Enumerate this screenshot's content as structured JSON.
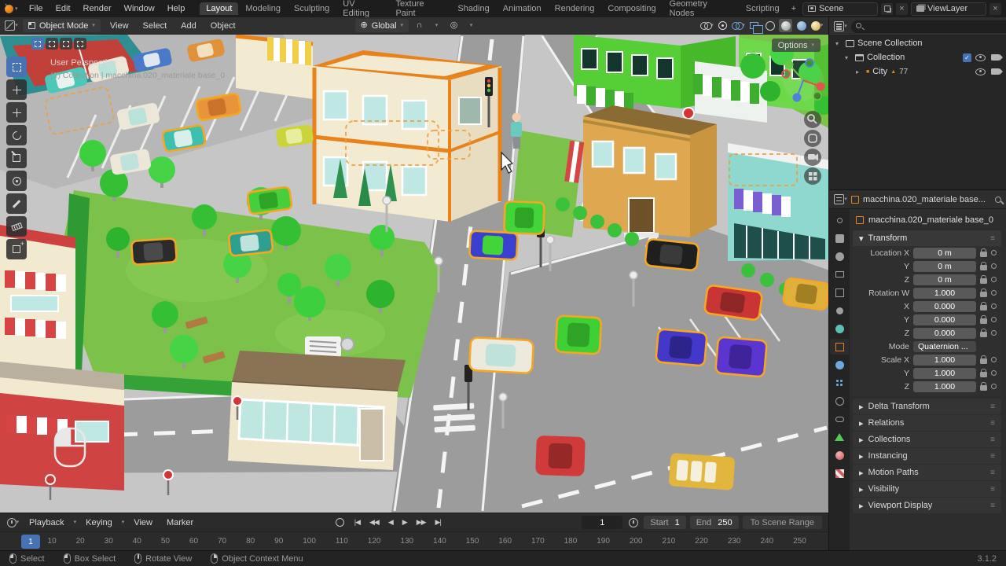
{
  "colors": {
    "accent": "#4772b3",
    "selection": "#f5a623",
    "obj-orange": "#e8821e"
  },
  "topbar": {
    "menus": [
      "File",
      "Edit",
      "Render",
      "Window",
      "Help"
    ],
    "workspaces": [
      "Layout",
      "Modeling",
      "Sculpting",
      "UV Editing",
      "Texture Paint",
      "Shading",
      "Animation",
      "Rendering",
      "Compositing",
      "Geometry Nodes",
      "Scripting"
    ],
    "add": "+",
    "scene": "Scene",
    "viewlayer": "ViewLayer"
  },
  "viewport_header": {
    "mode": "Object Mode",
    "menus": [
      "View",
      "Select",
      "Add",
      "Object"
    ],
    "orientation": "Global",
    "options": "Options"
  },
  "viewport": {
    "overlay_line1": "User Perspective",
    "overlay_line2": "(1) Collection | macchina.020_materiale base_0"
  },
  "outliner": {
    "rows": [
      "Scene Collection",
      "Collection",
      "City"
    ],
    "city_badge": "77"
  },
  "properties": {
    "breadcrumb": "macchina.020_materiale base...",
    "name": "macchina.020_materiale base_0",
    "transform": {
      "title": "Transform",
      "rows1": [
        {
          "label": "Location X",
          "value": "0 m"
        },
        {
          "label": "Y",
          "value": "0 m"
        },
        {
          "label": "Z",
          "value": "0 m"
        },
        {
          "label": "Rotation W",
          "value": "1.000"
        },
        {
          "label": "X",
          "value": "0.000"
        },
        {
          "label": "Y",
          "value": "0.000"
        },
        {
          "label": "Z",
          "value": "0.000"
        }
      ],
      "mode": {
        "label": "Mode",
        "value": "Quaternion ..."
      },
      "rows2": [
        {
          "label": "Scale X",
          "value": "1.000"
        },
        {
          "label": "Y",
          "value": "1.000"
        },
        {
          "label": "Z",
          "value": "1.000"
        }
      ]
    },
    "sections": [
      "Delta Transform",
      "Relations",
      "Collections",
      "Instancing",
      "Motion Paths",
      "Visibility",
      "Viewport Display"
    ]
  },
  "timeline": {
    "menus": [
      "Playback",
      "Keying",
      "View",
      "Marker"
    ],
    "frame_current": "1",
    "start_label": "Start",
    "start_value": "1",
    "end_label": "End",
    "end_value": "250",
    "range_button": "To Scene Range",
    "ticks": [
      "1",
      "10",
      "20",
      "30",
      "40",
      "50",
      "60",
      "70",
      "80",
      "90",
      "100",
      "110",
      "120",
      "130",
      "140",
      "150",
      "160",
      "170",
      "180",
      "190",
      "200",
      "210",
      "220",
      "230",
      "240",
      "250"
    ]
  },
  "statusbar": {
    "items": [
      "Select",
      "Box Select",
      "Rotate View",
      "Object Context Menu"
    ],
    "version": "3.1.2"
  }
}
